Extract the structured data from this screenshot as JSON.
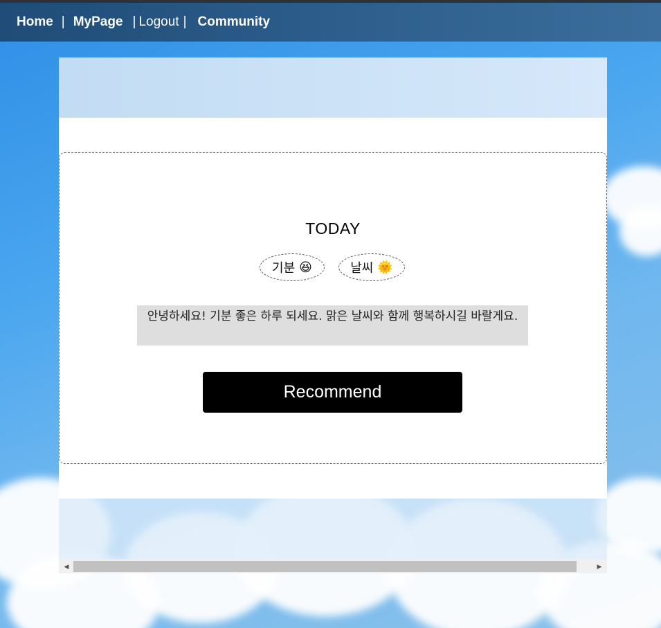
{
  "nav": {
    "home": "Home",
    "sep1": "|",
    "mypage": "MyPage",
    "sep2": "|",
    "logout": "Logout",
    "sep3": "|",
    "community": "Community"
  },
  "card": {
    "title": "TODAY",
    "mood_label": "기분",
    "mood_emoji": "😆",
    "weather_label": "날씨",
    "weather_emoji": "🌞",
    "message": "안녕하세요! 기분 좋은 하루 되세요. 맑은 날씨와 함께 행복하시길 바랄게요.",
    "recommend_label": "Recommend"
  },
  "scrollbar": {
    "left_arrow": "◀",
    "right_arrow": "▶"
  },
  "colors": {
    "navbar": "#2e5f8d",
    "button": "#000000",
    "message_bg": "#dedede"
  }
}
